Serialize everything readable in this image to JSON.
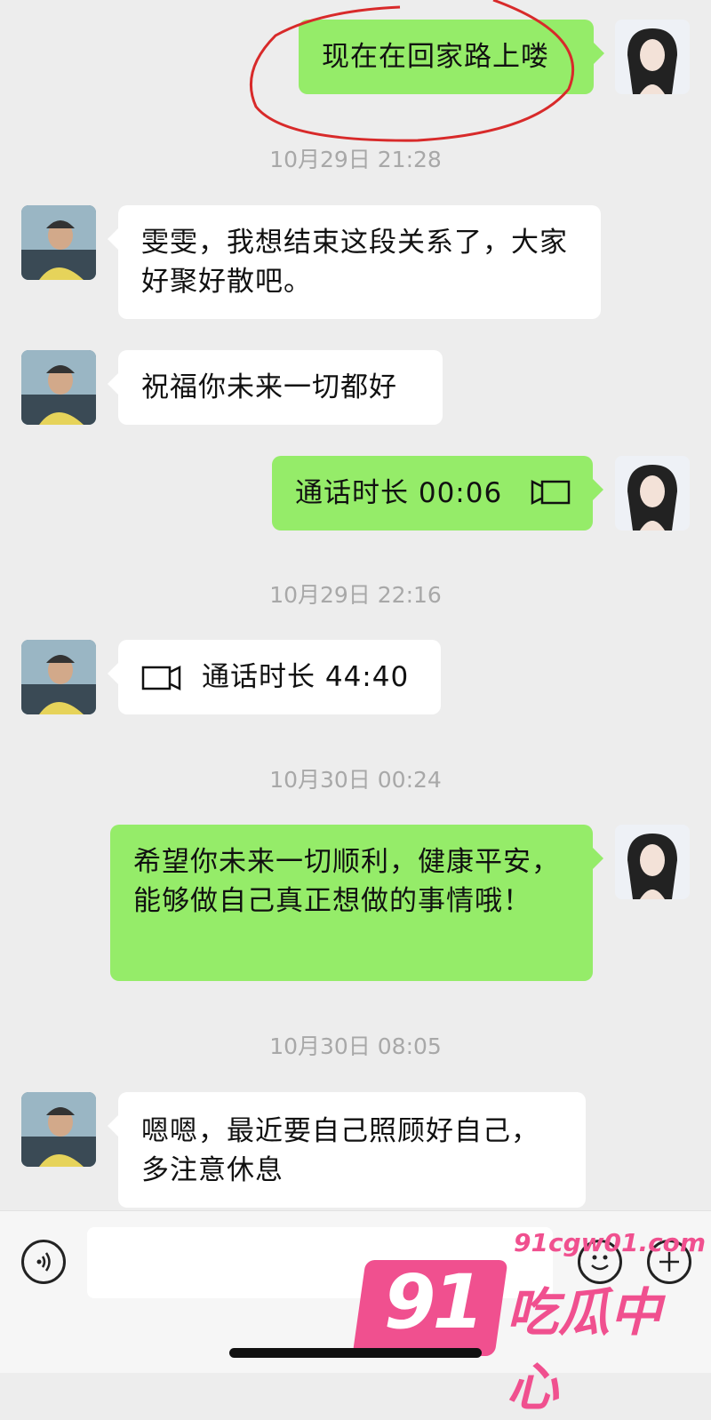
{
  "messages": [
    {
      "text": "现在在回家路上喽"
    },
    {
      "text": "10月29日 21:28"
    },
    {
      "text": "雯雯，我想结束这段关系了，大家好聚好散吧。"
    },
    {
      "text": "祝福你未来一切都好"
    },
    {
      "text": "通话时长 00:06"
    },
    {
      "text": "10月29日 22:16"
    },
    {
      "text": "通话时长 44:40"
    },
    {
      "text": "10月30日 00:24"
    },
    {
      "text": "希望你未来一切顺利，健康平安，能够做自己真正想做的事情哦！"
    },
    {
      "text": "10月30日 08:05"
    },
    {
      "text": "嗯嗯，最近要自己照顾好自己，多注意休息"
    }
  ],
  "watermark": {
    "number": "91",
    "url": "91cgw01.com",
    "brand": "吃瓜中心"
  },
  "icons": {
    "call": "video-call-icon",
    "voice": "voice-input-icon",
    "emoji": "emoji-icon",
    "plus": "plus-icon"
  },
  "colors": {
    "sent_bubble": "#95ec69",
    "received_bubble": "#ffffff",
    "background": "#ededed",
    "annotation": "#d82a2a",
    "watermark": "#f0508f"
  }
}
